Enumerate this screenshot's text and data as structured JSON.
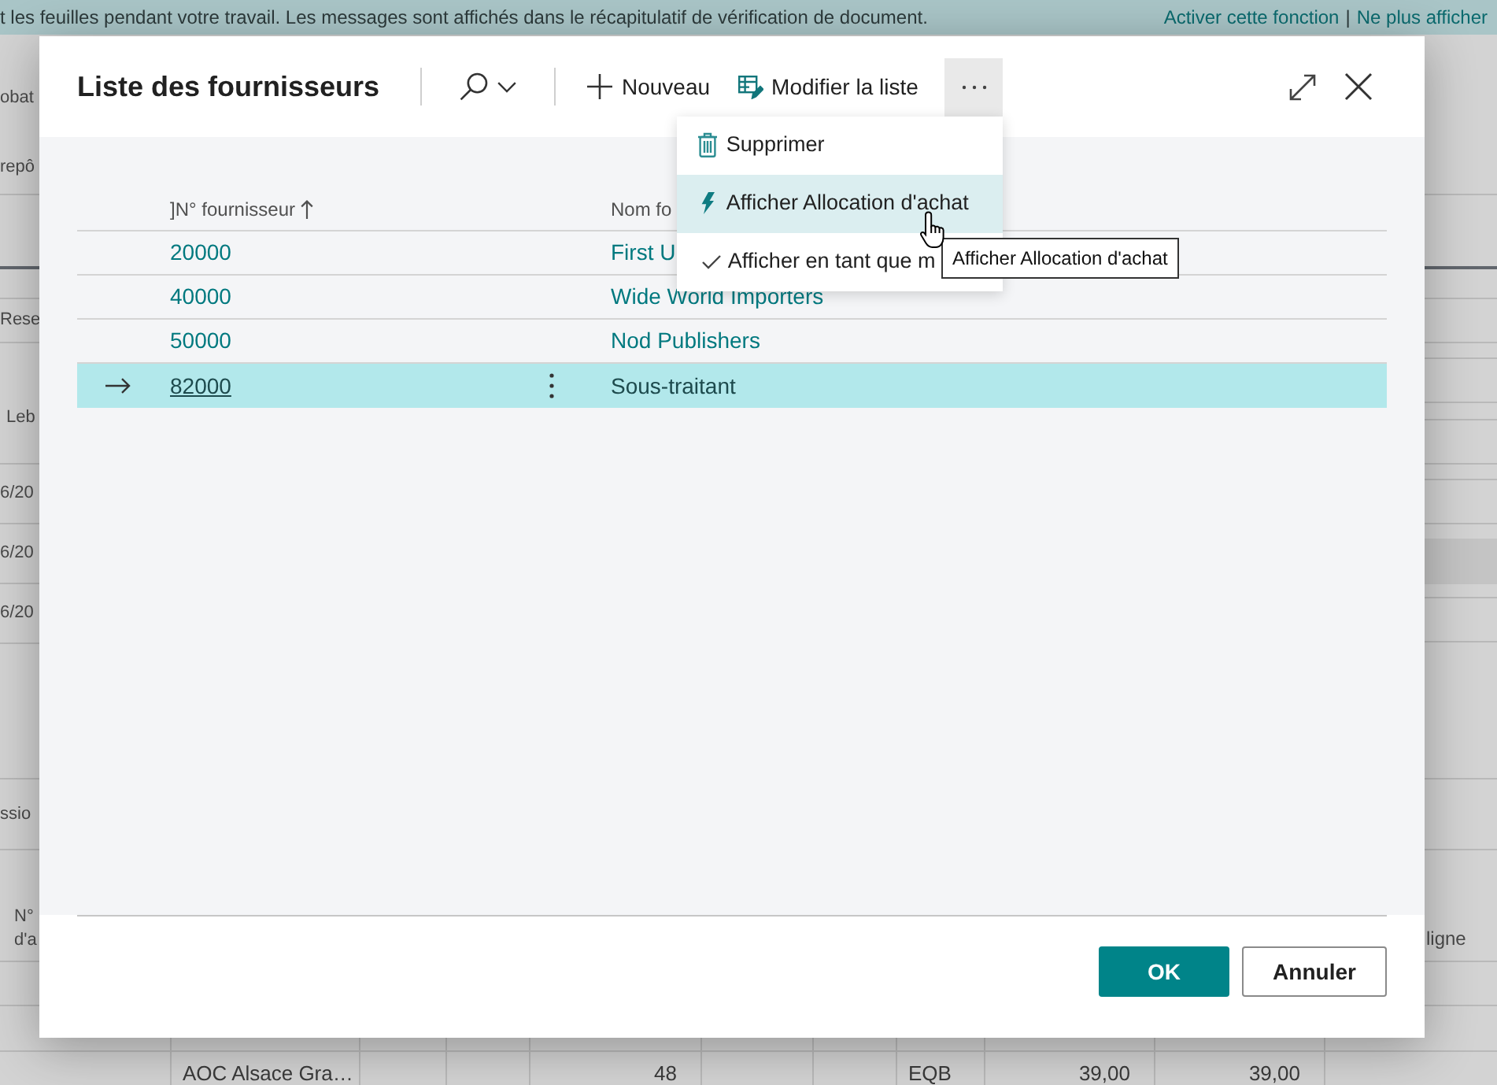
{
  "background_page": {
    "banner": {
      "message": "t les feuilles pendant votre travail. Les messages sont affichés dans le récapitulatif de vérification de document.",
      "links": [
        "Activer cette fonction",
        "Ne plus afficher"
      ],
      "separator": "|"
    },
    "left_edge_texts": [
      "obat",
      "repô",
      "Rese",
      "Leb",
      "6/20",
      "6/20",
      "6/20",
      "ssio",
      "N°",
      "d'a"
    ],
    "right_edge_texts": [
      "ligne"
    ],
    "bottom_row": [
      "AOC Alsace Gra…",
      "48",
      "EQB",
      "39,00",
      "39,00"
    ]
  },
  "dialog": {
    "title": "Liste des fournisseurs",
    "toolbar": [
      {
        "kind": "search"
      },
      {
        "kind": "new",
        "label": "Nouveau"
      },
      {
        "kind": "edit_list",
        "label": "Modifier la liste"
      },
      {
        "kind": "more",
        "expanded": true
      }
    ],
    "menu": [
      {
        "kind": "delete",
        "label": "Supprimer",
        "highlighted": false
      },
      {
        "kind": "action",
        "label": "Afficher Allocation d'achat",
        "highlighted": true
      },
      {
        "kind": "check",
        "label": "Afficher en tant que m",
        "highlighted": false
      }
    ],
    "tooltip": "Afficher Allocation d'achat",
    "table": {
      "columns": [
        {
          "label": "]N° fournisseur",
          "sorted": true
        },
        {
          "label": "Nom fo"
        }
      ],
      "rows": [
        {
          "number": "20000",
          "name": "First U",
          "selected": false
        },
        {
          "number": "40000",
          "name": "Wide World Importers",
          "selected": false
        },
        {
          "number": "50000",
          "name": "Nod Publishers",
          "selected": false
        },
        {
          "number": "82000",
          "name": "Sous-traitant",
          "selected": true
        }
      ]
    },
    "buttons": [
      {
        "kind": "primary",
        "label": "OK"
      },
      {
        "kind": "secondary",
        "label": "Annuler"
      }
    ]
  }
}
